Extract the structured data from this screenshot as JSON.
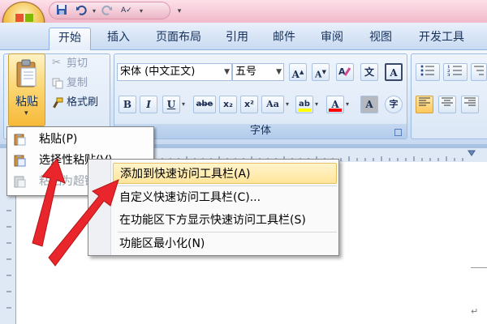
{
  "quick_access_toolbar": {
    "save_icon": "save-icon",
    "undo_icon": "undo-icon",
    "redo_icon": "redo-icon",
    "spelling_icon": "spelling-check-icon",
    "customize_icon": "chevron-down-icon"
  },
  "tabs": [
    {
      "label": "开始",
      "active": true
    },
    {
      "label": "插入"
    },
    {
      "label": "页面布局"
    },
    {
      "label": "引用"
    },
    {
      "label": "邮件"
    },
    {
      "label": "审阅"
    },
    {
      "label": "视图"
    },
    {
      "label": "开发工具"
    }
  ],
  "clipboard": {
    "paste_label": "粘贴",
    "cut_label": "剪切",
    "copy_label": "复制",
    "format_painter_label": "格式刷"
  },
  "font_group": {
    "font_name": "宋体 (中文正文)",
    "font_size": "五号",
    "label": "字体",
    "buttons": {
      "grow": "A",
      "shrink": "A",
      "phonetic": "文",
      "border": "A",
      "bold": "B",
      "italic": "I",
      "underline": "U",
      "strike": "abe",
      "subscript": "x₂",
      "superscript": "x²",
      "change_case": "Aa",
      "highlight": "ab",
      "font_color": "A",
      "char_shading": "A",
      "enclose": "字"
    },
    "highlight_color": "#ffff00",
    "font_color_value": "#ff0000"
  },
  "paste_menu": {
    "items": [
      {
        "label": "粘贴(P)",
        "disabled": false
      },
      {
        "label": "选择性粘贴(V)...",
        "disabled": false
      },
      {
        "label": "粘贴为超链接(H)",
        "disabled": true
      }
    ]
  },
  "context_menu": {
    "items": [
      {
        "label": "添加到快速访问工具栏(A)",
        "highlighted": true
      },
      {
        "label": "自定义快速访问工具栏(C)..."
      },
      {
        "label": "在功能区下方显示快速访问工具栏(S)"
      },
      {
        "label": "功能区最小化(N)"
      }
    ]
  },
  "colors": {
    "title_bar": "#f2b9cb",
    "ribbon": "#d9e6f6",
    "arrow": "#e8262b"
  }
}
